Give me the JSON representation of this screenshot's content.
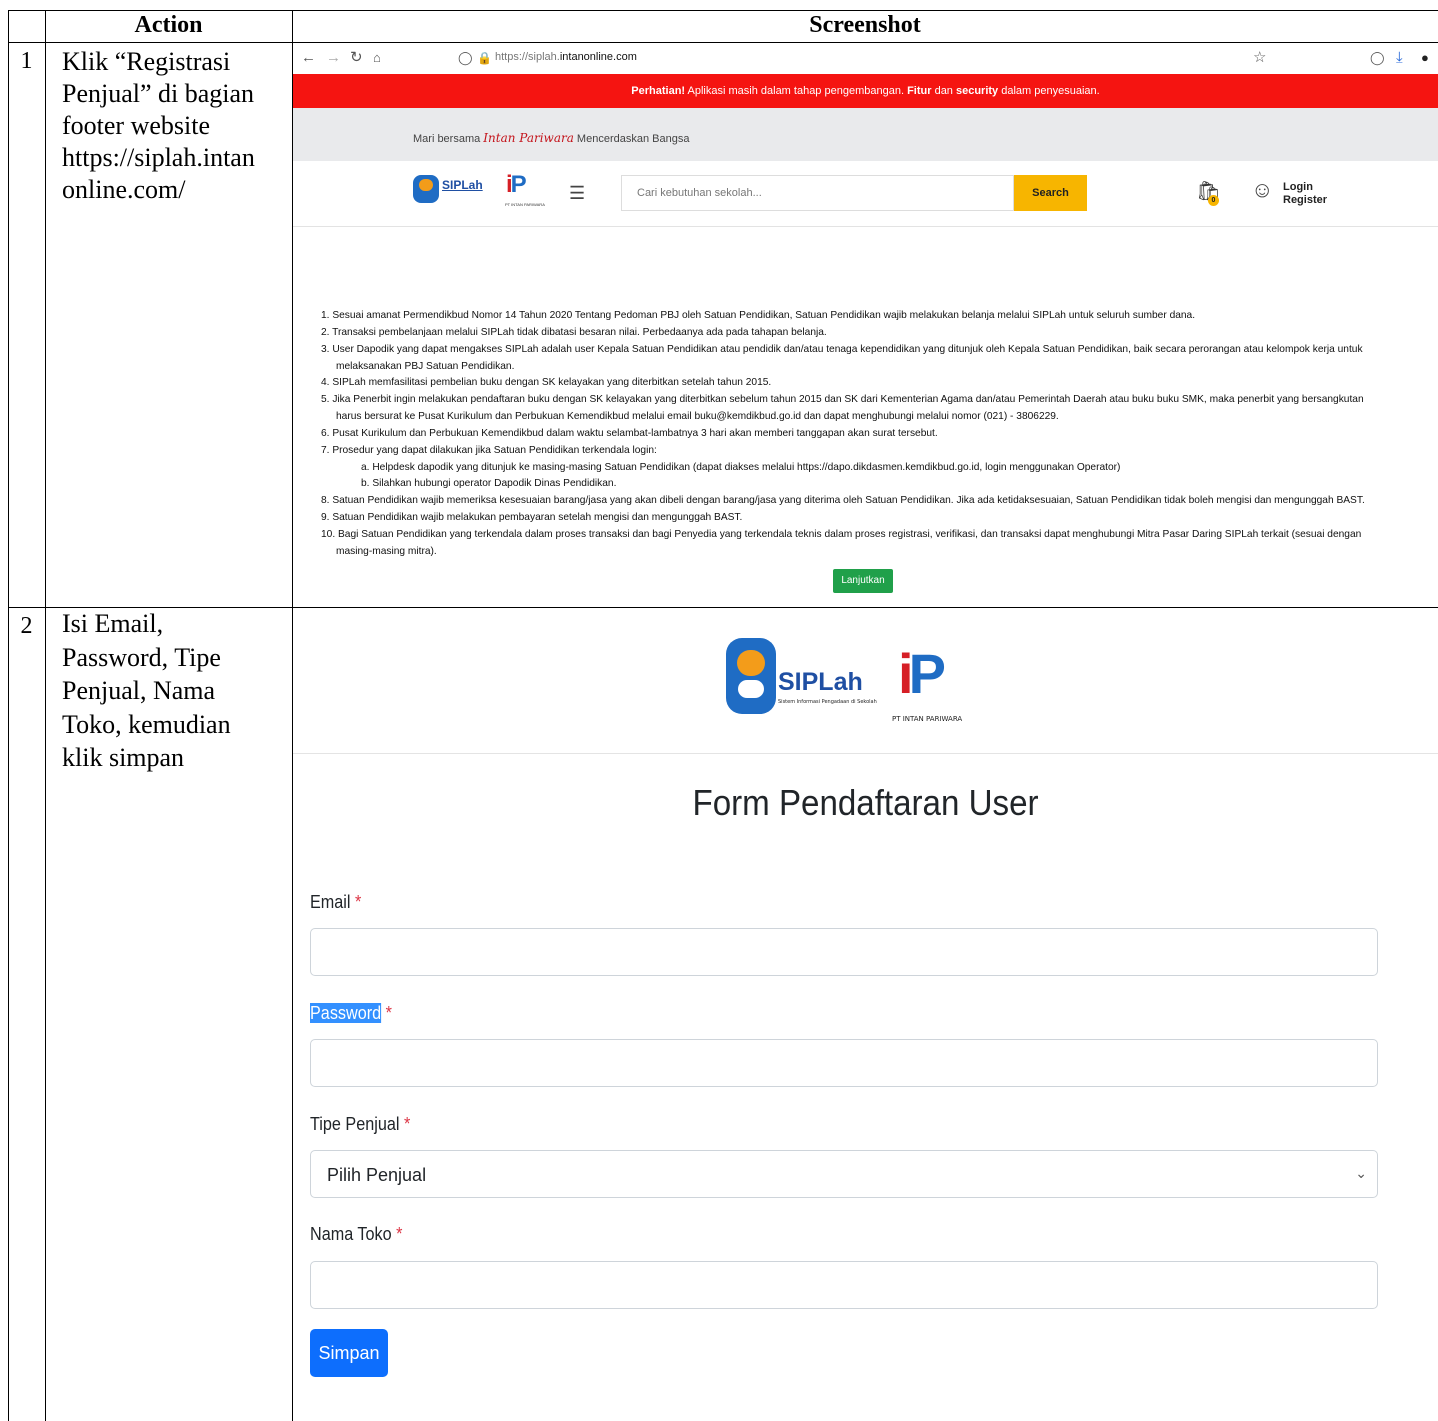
{
  "table": {
    "header_action": "Action",
    "header_screenshot": "Screenshot",
    "rows": [
      {
        "num": "1",
        "action_lines": [
          "Klik “Registrasi",
          "Penjual” di bagian",
          "footer website",
          "https://siplah.intan",
          "online.com/"
        ]
      },
      {
        "num": "2",
        "action_lines": [
          "Isi Email,",
          "Password, Tipe",
          "Penjual, Nama",
          "Toko, kemudian",
          "klik simpan"
        ]
      }
    ]
  },
  "screen1": {
    "browser": {
      "url_prefix": "https://siplah.",
      "url_domain": "intanonline.com"
    },
    "warning": {
      "lead": "Perhatian!",
      "text1": " Aplikasi masih dalam tahap pengembangan. ",
      "b1": "Fitur",
      "text2": " dan ",
      "b2": "security",
      "text3": " dalam penyesuaian."
    },
    "tagline": {
      "pre": "Mari bersama ",
      "brand": "Intan Pariwara",
      "post": " Mencerdaskan Bangsa"
    },
    "nav": {
      "logo_text": "SIPLah",
      "logo_sub": "PT INTAN PARIWARA",
      "search_placeholder": "Cari kebutuhan sekolah...",
      "search_button": "Search",
      "cart_count": "0",
      "login": "Login",
      "register": "Register"
    },
    "rules": [
      "1. Sesuai amanat Permendikbud Nomor 14 Tahun 2020 Tentang Pedoman PBJ oleh Satuan Pendidikan, Satuan Pendidikan wajib melakukan belanja melalui SIPLah untuk seluruh sumber dana.",
      "2. Transaksi pembelanjaan melalui SIPLah tidak dibatasi besaran nilai. Perbedaanya ada pada tahapan belanja.",
      "3. User Dapodik yang dapat mengakses SIPLah adalah user Kepala Satuan Pendidikan atau pendidik dan/atau tenaga kependidikan yang ditunjuk oleh Kepala Satuan Pendidikan, baik secara perorangan atau kelompok kerja untuk",
      "melaksanakan PBJ Satuan Pendidikan.",
      "4. SIPLah memfasilitasi pembelian buku dengan SK kelayakan yang diterbitkan setelah tahun 2015.",
      "5. Jika Penerbit ingin melakukan pendaftaran buku dengan SK kelayakan yang diterbitkan sebelum tahun 2015 dan SK dari Kementerian Agama dan/atau Pemerintah Daerah atau buku buku SMK, maka penerbit yang bersangkutan",
      "harus bersurat ke Pusat Kurikulum dan Perbukuan Kemendikbud melalui email buku@kemdikbud.go.id dan dapat menghubungi melalui nomor (021) - 3806229.",
      "6. Pusat Kurikulum dan Perbukuan Kemendikbud dalam waktu selambat-lambatnya 3 hari akan memberi tanggapan akan surat tersebut.",
      "7. Prosedur yang dapat dilakukan jika Satuan Pendidikan terkendala login:",
      "a. Helpdesk dapodik yang ditunjuk ke masing-masing Satuan Pendidikan (dapat diakses melalui https://dapo.dikdasmen.kemdikbud.go.id, login menggunakan Operator)",
      "b. Silahkan hubungi operator Dapodik Dinas Pendidikan.",
      "8. Satuan Pendidikan wajib memeriksa kesesuaian barang/jasa yang akan dibeli dengan barang/jasa yang diterima oleh Satuan Pendidikan. Jika ada ketidaksesuaian, Satuan Pendidikan tidak boleh mengisi dan mengunggah BAST.",
      "9. Satuan Pendidikan wajib melakukan pembayaran setelah mengisi dan mengunggah BAST.",
      "10. Bagi Satuan Pendidikan yang terkendala dalam proses transaksi dan bagi Penyedia yang terkendala teknis dalam proses registrasi, verifikasi, dan transaksi dapat menghubungi Mitra Pasar Daring SIPLah terkait (sesuai dengan",
      "masing-masing mitra)."
    ],
    "continue_button": "Lanjutkan"
  },
  "screen2": {
    "logo_text": "SIPLah",
    "logo_sub": "Sistem Informasi Pengadaan di Sekolah",
    "ip_sub": "PT INTAN PARIWARA",
    "title": "Form Pendaftaran User",
    "fields": {
      "email": "Email",
      "password": "Password",
      "tipe": "Tipe Penjual",
      "tipe_value": "Pilih Penjual",
      "toko": "Nama Toko",
      "required_mark": "*"
    },
    "submit": "Simpan"
  }
}
